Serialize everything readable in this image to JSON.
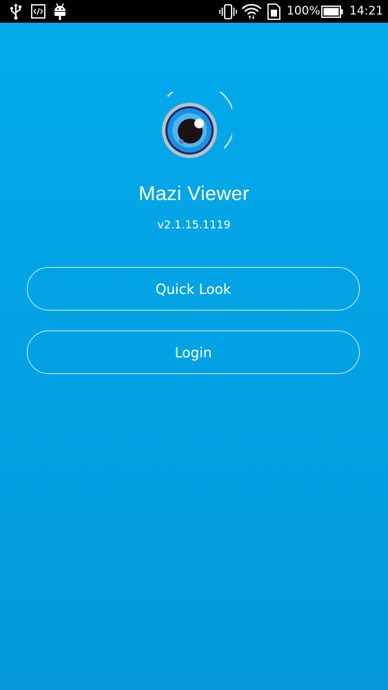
{
  "status_bar": {
    "left_icons": [
      "usb-icon",
      "developer-code-icon",
      "android-icon"
    ],
    "right_icons": [
      "vibrate-icon",
      "wifi-icon",
      "sim-card-icon",
      "battery-icon"
    ],
    "battery_percent": "100%",
    "battery_level": 1.0,
    "time": "14:21"
  },
  "app": {
    "title": "Mazi Viewer",
    "version": "v2.1.15.1119",
    "logo_icon": "eye-logo-icon",
    "background_color": "#03aaeb",
    "accent_color": "#ffffff"
  },
  "actions": {
    "quick_look_label": "Quick Look",
    "login_label": "Login"
  }
}
